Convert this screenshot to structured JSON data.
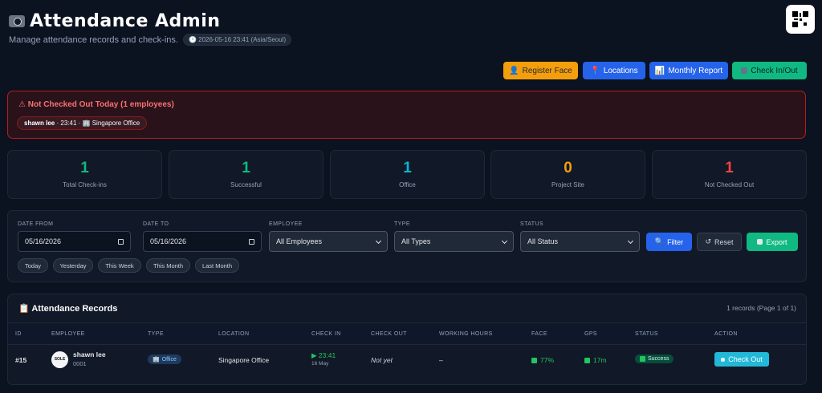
{
  "header": {
    "title": "Attendance Admin",
    "subtitle": "Manage attendance records and check-ins.",
    "datetime": "2026-05-16 23:41 (Asia/Seoul)"
  },
  "actions": {
    "register_face": "Register Face",
    "locations": "Locations",
    "monthly_report": "Monthly Report",
    "check_in_out": "Check In/Out"
  },
  "alert": {
    "title": "Not Checked Out Today (1 employees)",
    "entry_name": "shawn lee",
    "entry_detail": "· 23:41 ·",
    "entry_location": "Singapore Office"
  },
  "stats": [
    {
      "value": "1",
      "label": "Total Check-ins",
      "color": "#10b981"
    },
    {
      "value": "1",
      "label": "Successful",
      "color": "#10b981"
    },
    {
      "value": "1",
      "label": "Office",
      "color": "#06b6d4"
    },
    {
      "value": "0",
      "label": "Project Site",
      "color": "#f59e0b"
    },
    {
      "value": "1",
      "label": "Not Checked Out",
      "color": "#ef4444"
    }
  ],
  "filters": {
    "date_from_label": "DATE FROM",
    "date_from_value": "05/16/2026",
    "date_to_label": "DATE TO",
    "date_to_value": "05/16/2026",
    "employee_label": "EMPLOYEE",
    "employee_value": "All Employees",
    "type_label": "TYPE",
    "type_value": "All Types",
    "status_label": "STATUS",
    "status_value": "All Status",
    "filter_btn": "Filter",
    "reset_btn": "Reset",
    "export_btn": "Export",
    "quick": [
      "Today",
      "Yesterday",
      "This Week",
      "This Month",
      "Last Month"
    ]
  },
  "records": {
    "title": "Attendance Records",
    "count": "1 records (Page 1 of 1)",
    "columns": [
      "ID",
      "EMPLOYEE",
      "TYPE",
      "LOCATION",
      "CHECK IN",
      "CHECK OUT",
      "WORKING HOURS",
      "FACE",
      "GPS",
      "STATUS",
      "ACTION"
    ],
    "rows": [
      {
        "id": "#15",
        "avatar_text": "SOLE",
        "name": "shawn lee",
        "emp_no": "0001",
        "type": "Office",
        "location": "Singapore Office",
        "check_in_time": "23:41",
        "check_in_date": "16 May",
        "check_out": "Not yet",
        "working_hours": "–",
        "face": "77%",
        "gps": "17m",
        "status": "Success",
        "action": "Check Out"
      }
    ]
  },
  "colors": {
    "accent_green": "#10b981",
    "accent_blue": "#2563eb",
    "accent_amber": "#f59e0b",
    "accent_red": "#ef4444",
    "accent_cyan": "#06b6d4"
  }
}
